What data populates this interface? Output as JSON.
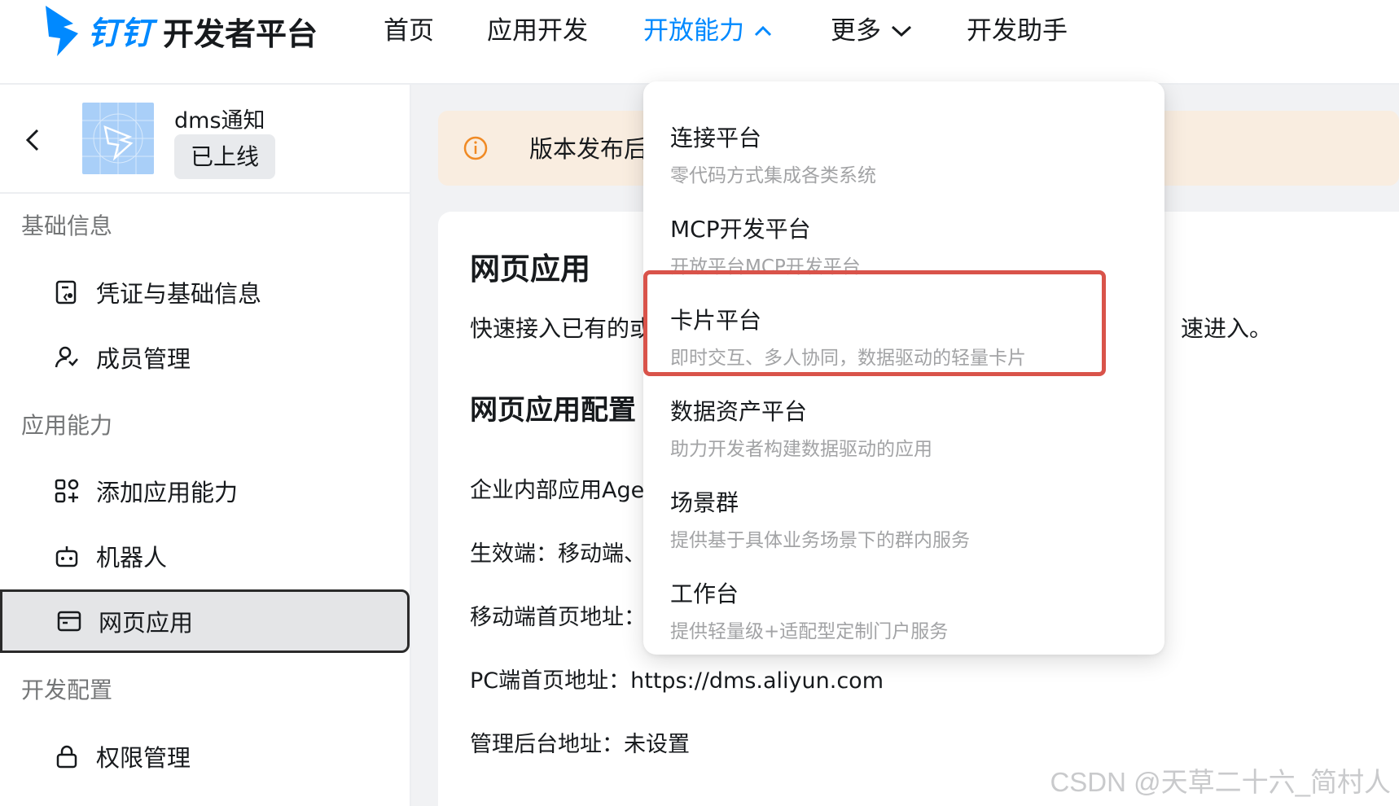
{
  "nav": {
    "brand_name": "钉钉",
    "brand_sub": "开发者平台",
    "items": [
      {
        "label": "首页"
      },
      {
        "label": "应用开发"
      },
      {
        "label": "开放能力"
      },
      {
        "label": "更多"
      },
      {
        "label": "开发助手"
      }
    ],
    "active_color": "#0089ff"
  },
  "app": {
    "name": "dms通知",
    "status_badge": "已上线"
  },
  "sidebar": {
    "groups": [
      {
        "title": "基础信息",
        "items": [
          {
            "label": "凭证与基础信息",
            "icon": "credential-icon"
          },
          {
            "label": "成员管理",
            "icon": "user-icon"
          }
        ]
      },
      {
        "title": "应用能力",
        "items": [
          {
            "label": "添加应用能力",
            "icon": "apps-add-icon"
          },
          {
            "label": "机器人",
            "icon": "robot-icon"
          },
          {
            "label": "网页应用",
            "icon": "browser-icon",
            "active": true
          }
        ]
      },
      {
        "title": "开发配置",
        "items": [
          {
            "label": "权限管理",
            "icon": "lock-icon"
          }
        ]
      }
    ]
  },
  "notice": {
    "text": "版本发布后，"
  },
  "main": {
    "title": "网页应用",
    "desc": "快速接入已有的或",
    "desc_tail": "速进入。",
    "config_title": "网页应用配置",
    "fields": [
      {
        "text": "企业内部应用Age"
      },
      {
        "text": "生效端：移动端、"
      },
      {
        "text": "移动端首页地址："
      },
      {
        "text": "PC端首页地址：https://dms.aliyun.com"
      },
      {
        "text": "管理后台地址：未设置"
      }
    ]
  },
  "dropdown": {
    "items": [
      {
        "title": "连接平台",
        "desc": "零代码方式集成各类系统"
      },
      {
        "title": "MCP开发平台",
        "desc": "开放平台MCP开发平台"
      },
      {
        "title": "卡片平台",
        "desc": "即时交互、多人协同，数据驱动的轻量卡片",
        "highlighted": true
      },
      {
        "title": "数据资产平台",
        "desc": "助力开发者构建数据驱动的应用"
      },
      {
        "title": "场景群",
        "desc": "提供基于具体业务场景下的群内服务"
      },
      {
        "title": "工作台",
        "desc": "提供轻量级+适配型定制门户服务"
      }
    ],
    "highlight_color": "#d9534a"
  },
  "watermark": "CSDN @天草二十六_简村人"
}
